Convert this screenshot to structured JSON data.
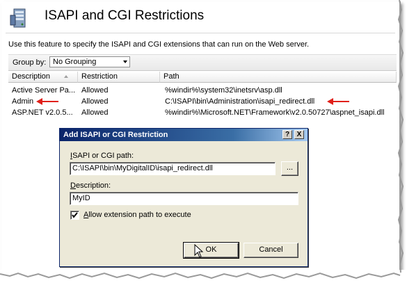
{
  "header": {
    "title": "ISAPI and CGI Restrictions",
    "description": "Use this feature to specify the ISAPI and CGI extensions that can run on the Web server."
  },
  "groupby": {
    "label": "Group by:",
    "selected": "No Grouping"
  },
  "table": {
    "columns": [
      "Description",
      "Restriction",
      "Path"
    ],
    "rows": [
      {
        "description": "Active Server Pa...",
        "restriction": "Allowed",
        "path": "%windir%\\system32\\inetsrv\\asp.dll"
      },
      {
        "description": "Admin",
        "restriction": "Allowed",
        "path": "C:\\ISAPI\\bin\\Administration\\isapi_redirect.dll"
      },
      {
        "description": "ASP.NET v2.0.5...",
        "restriction": "Allowed",
        "path": "%windir%\\Microsoft.NET\\Framework\\v2.0.50727\\aspnet_isapi.dll"
      }
    ]
  },
  "dialog": {
    "title": "Add ISAPI or CGI Restriction",
    "help_label": "?",
    "close_label": "X",
    "path_label": "ISAPI or CGI path:",
    "path_value": "C:\\ISAPI\\bin\\MyDigitalID\\isapi_redirect.dll",
    "browse_label": "...",
    "desc_label": "Description:",
    "desc_value": "MyID",
    "allow_label": "Allow extension path to execute",
    "allow_checked": true,
    "ok_label": "OK",
    "cancel_label": "Cancel"
  },
  "colors": {
    "arrow": "#e0201a",
    "dialog_title_start": "#0a246a",
    "dialog_title_end": "#a6caf0"
  }
}
